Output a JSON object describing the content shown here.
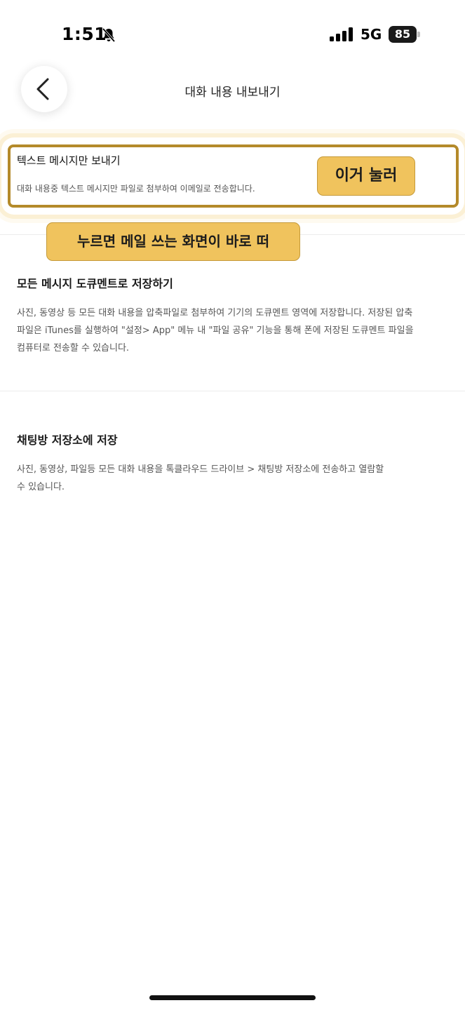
{
  "status_bar": {
    "time": "1:51",
    "network": "5G",
    "battery": "85",
    "icons": [
      "bell-slash-icon",
      "signal-icon"
    ]
  },
  "header": {
    "title": "대화 내용 내보내기",
    "back_icon": "chevron-left-icon"
  },
  "options": [
    {
      "title": "텍스트 메시지만 보내기",
      "desc_lines": [
        "대화 내용중 텍스트 메시지만 파일로 첨부하여 이메일로 전송합니다."
      ]
    },
    {
      "title": "모든 메시지 도큐멘트로 저장하기",
      "desc_lines": [
        "사진, 동영상 등 모든 대화 내용을 압축파일로 첨부하여 기기의 도큐멘트 영역에 저장합니다. 저장된 압축",
        "파일은 iTunes를 실행하여 \"설정> App\" 메뉴 내 \"파일 공유\" 기능을 통해 폰에 저장된 도큐멘트 파일을",
        "컴퓨터로 전송할 수 있습니다."
      ]
    },
    {
      "title": "채팅방 저장소에 저장",
      "desc_lines": [
        "사진, 동영상, 파일등 모든 대화 내용을 톡클라우드 드라이브 > 채팅방 저장소에 전송하고 열람할",
        "수 있습니다."
      ]
    }
  ],
  "annotations": {
    "tap_here": "이거 눌러",
    "mail_note": "누르면 메일 쓰는 화면이 바로 떠"
  },
  "colors": {
    "callout_fill": "#f0c35d",
    "highlight_border": "#b48a2a"
  }
}
